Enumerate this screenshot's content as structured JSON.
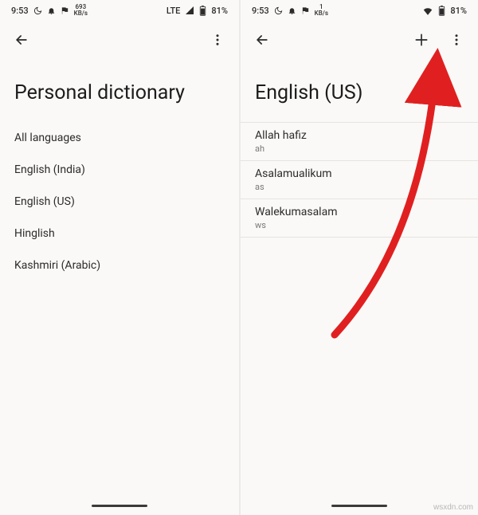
{
  "status": {
    "time": "9:53",
    "net_left": {
      "speed": "693",
      "unit": "KB/s"
    },
    "net_right": {
      "speed": "1",
      "unit": "KB/s"
    },
    "lte": "LTE",
    "battery": "81%"
  },
  "left": {
    "title": "Personal dictionary",
    "languages": [
      "All languages",
      "English (India)",
      "English (US)",
      "Hinglish",
      "Kashmiri (Arabic)"
    ]
  },
  "right": {
    "title": "English (US)",
    "words": [
      {
        "word": "Allah hafiz",
        "shortcut": "ah"
      },
      {
        "word": "Asalamualikum",
        "shortcut": "as"
      },
      {
        "word": "Walekumasalam",
        "shortcut": "ws"
      }
    ]
  },
  "watermark": "wsxdn.com"
}
